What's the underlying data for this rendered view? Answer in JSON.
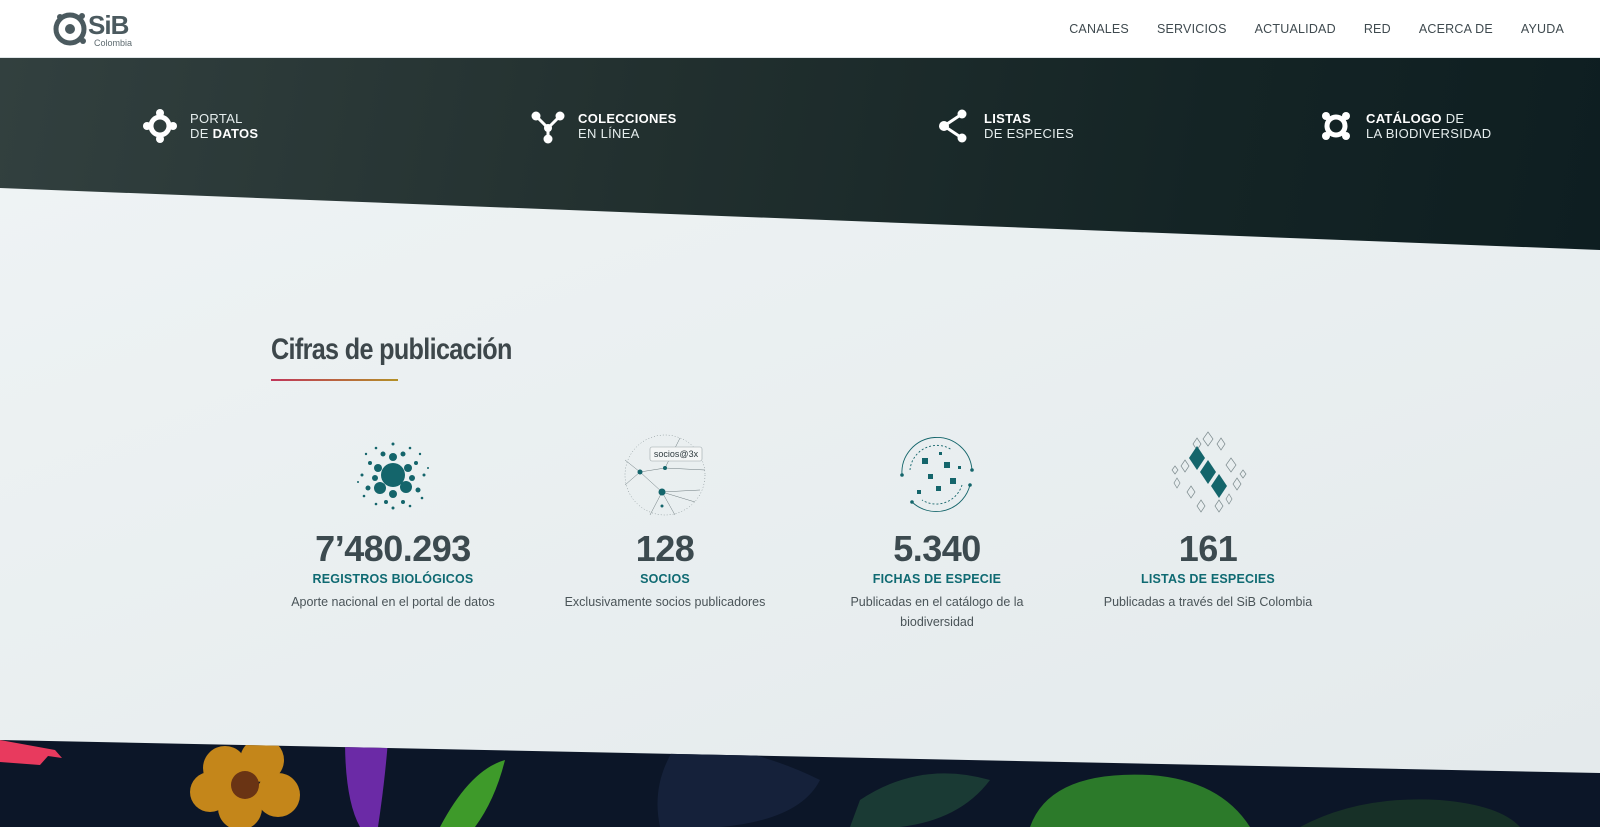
{
  "brand": {
    "logo_text": "SiB",
    "logo_sub": "Colombia"
  },
  "nav": {
    "items": [
      "CANALES",
      "SERVICIOS",
      "ACTUALIDAD",
      "RED",
      "ACERCA DE",
      "AYUDA"
    ]
  },
  "channels": [
    {
      "line1": "PORTAL",
      "line2_plain": "DE ",
      "line2_bold": "DATOS",
      "icon": "portal-icon"
    },
    {
      "line1_bold": "COLECCIONES",
      "line2_plain": "EN LÍNEA",
      "icon": "collections-icon"
    },
    {
      "line1_bold": "LISTAS",
      "line2_plain": "DE ESPECIES",
      "icon": "species-lists-icon"
    },
    {
      "line1_bold": "CATÁLOGO",
      "line1_plain": " DE",
      "line2_plain": "LA BIODIVERSIDAD",
      "icon": "catalog-icon"
    }
  ],
  "section": {
    "title": "Cifras de publicación"
  },
  "stats": [
    {
      "value": "7’480.293",
      "label": "REGISTROS BIOLÓGICOS",
      "desc": "Aporte nacional en el portal de datos",
      "icon": "records-icon"
    },
    {
      "value": "128",
      "label": "SOCIOS",
      "desc": "Exclusivamente socios publicadores",
      "icon": "partners-icon",
      "icon_tooltip": "socios@3x"
    },
    {
      "value": "5.340",
      "label": "FICHAS DE ESPECIE",
      "desc": "Publicadas en el catálogo de la biodiversidad",
      "icon": "species-sheets-icon"
    },
    {
      "value": "161",
      "label": "LISTAS DE ESPECIES",
      "desc": "Publicadas a través del SiB Colombia",
      "icon": "lists-icon"
    }
  ],
  "colors": {
    "accent": "#0f6a72",
    "dark_band": "#142425",
    "value_text": "#3c4a4f",
    "underline_start": "#c0365a",
    "underline_end": "#b39027"
  }
}
